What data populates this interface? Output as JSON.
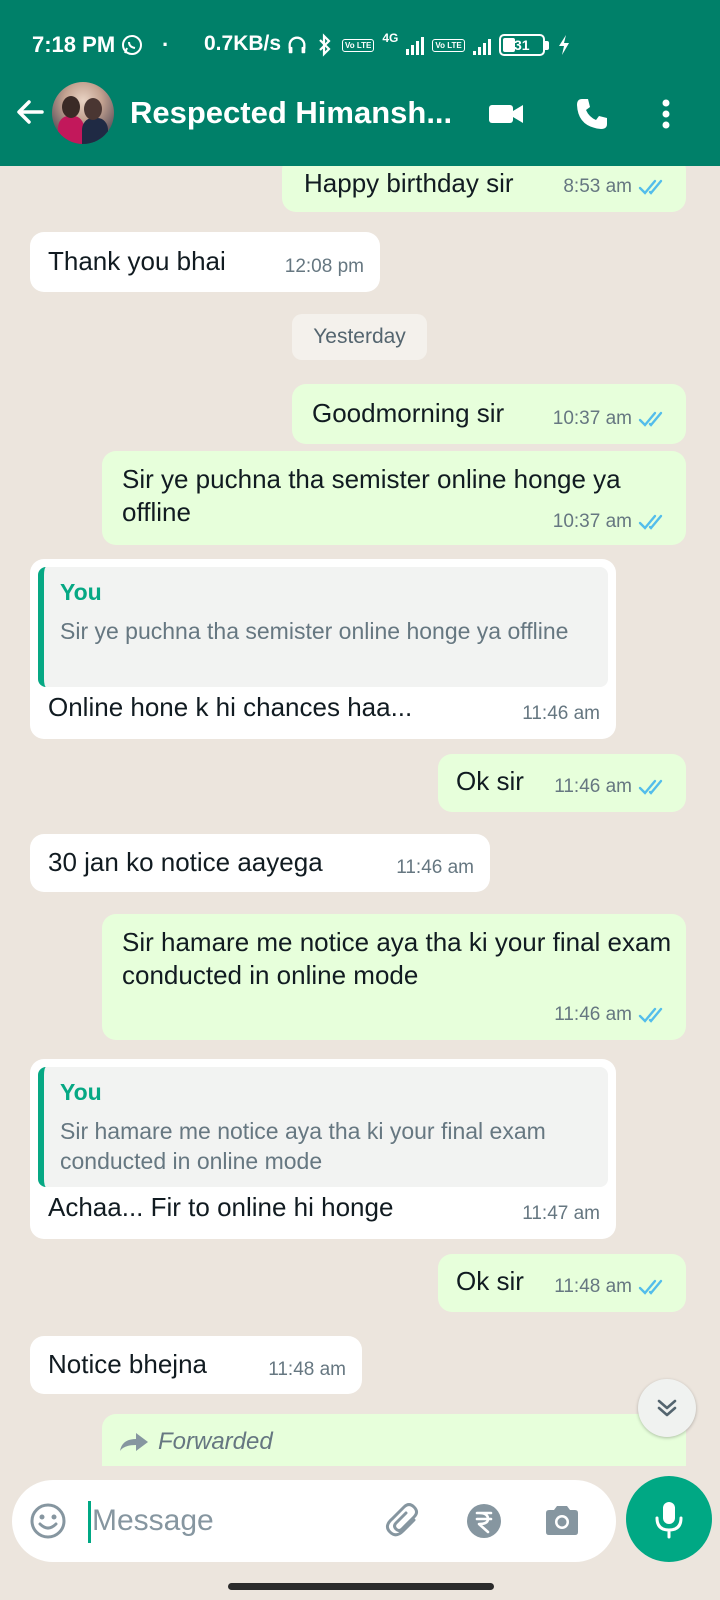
{
  "status_bar": {
    "time": "7:18 PM",
    "dot": "·",
    "speed": "0.7KB/s",
    "network": "4G",
    "volte": "Vo LTE",
    "battery": "31"
  },
  "header": {
    "contact_name": "Respected Himansh...",
    "icons": [
      "back-arrow-icon",
      "video-call-icon",
      "phone-icon",
      "more-vert-icon"
    ]
  },
  "chat": {
    "date_chip": "Yesterday",
    "messages": [
      {
        "dir": "out",
        "text": "Happy birthday sir",
        "time": "8:53 am"
      },
      {
        "dir": "in",
        "text": "Thank you bhai",
        "time": "12:08 pm"
      },
      {
        "dir": "out",
        "text": "Goodmorning sir",
        "time": "10:37 am"
      },
      {
        "dir": "out",
        "text": "Sir ye puchna tha semister online honge ya offline",
        "time": "10:37 am"
      },
      {
        "dir": "in",
        "quote_author": "You",
        "quote_text": "Sir ye puchna tha semister online honge ya offline",
        "text": "Online hone k hi chances haa...",
        "time": "11:46 am"
      },
      {
        "dir": "out",
        "text": "Ok sir",
        "time": "11:46 am"
      },
      {
        "dir": "in",
        "text": "30 jan ko notice aayega",
        "time": "11:46 am"
      },
      {
        "dir": "out",
        "text": "Sir hamare me notice aya tha ki your final exam conducted in online mode",
        "time": "11:46 am"
      },
      {
        "dir": "in",
        "quote_author": "You",
        "quote_text": "Sir hamare me notice aya tha ki your final exam conducted in online mode",
        "text": "Achaa... Fir to online hi honge",
        "time": "11:47 am"
      },
      {
        "dir": "out",
        "text": "Ok sir",
        "time": "11:48 am"
      },
      {
        "dir": "in",
        "text": "Notice bhejna",
        "time": "11:48 am"
      },
      {
        "dir": "out",
        "forwarded_label": "Forwarded"
      }
    ]
  },
  "composer": {
    "placeholder": "Message",
    "icons": [
      "emoji-icon",
      "attach-icon",
      "rupee-payment-icon",
      "camera-icon",
      "mic-icon"
    ]
  },
  "colors": {
    "header": "#008069",
    "outgoing_bubble": "#e7ffdb",
    "incoming_bubble": "#ffffff",
    "background": "#ece5dd",
    "accent": "#00a884",
    "read_ticks": "#53bdeb"
  }
}
